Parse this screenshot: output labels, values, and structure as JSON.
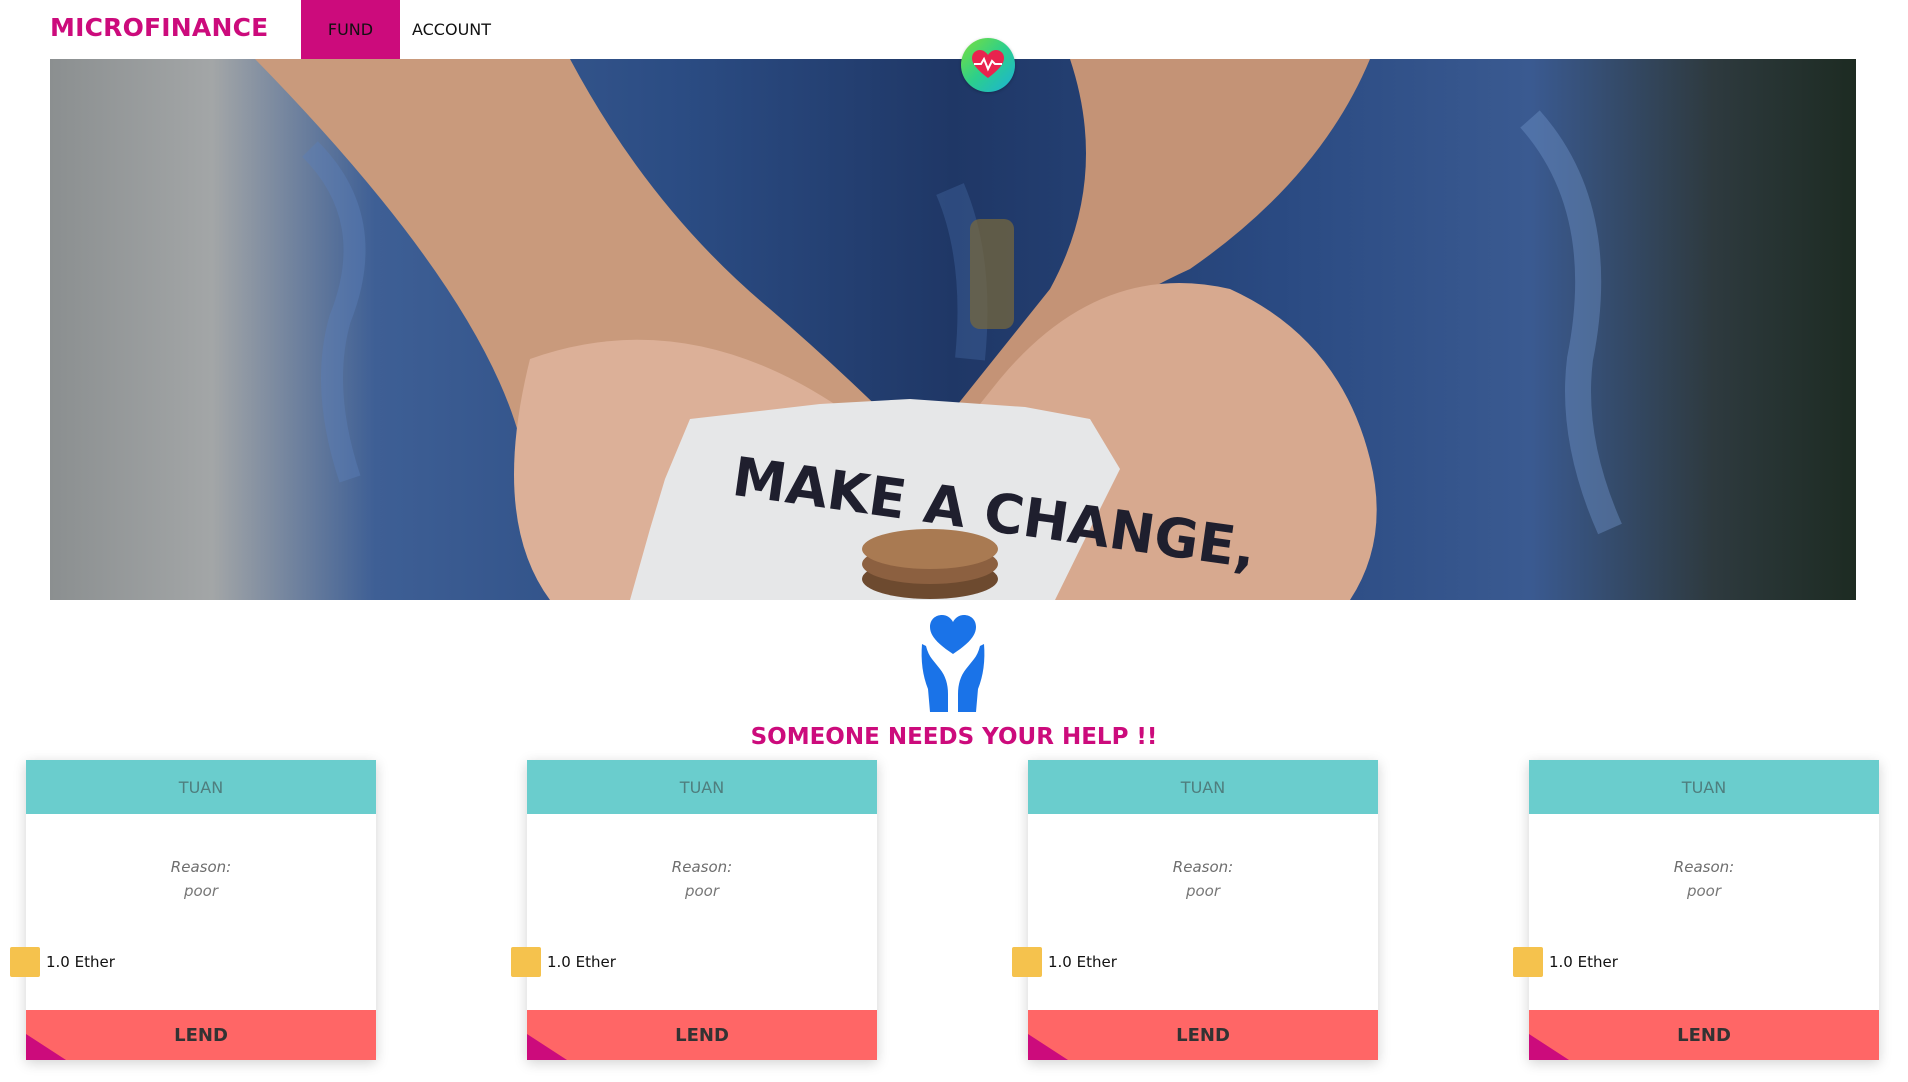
{
  "nav": {
    "brand": "MICROFINANCE",
    "items": [
      {
        "label": "FUND",
        "active": true
      },
      {
        "label": "ACCOUNT",
        "active": false
      }
    ],
    "accent_color": "#cc0b7c"
  },
  "hero": {
    "note_text": "MAKE A CHANGE,",
    "logo_icon": "heart-pulse-icon"
  },
  "help": {
    "icon": "hands-heart-icon",
    "title": "SOMEONE NEEDS YOUR HELP !!"
  },
  "cards": [
    {
      "name": "TUAN",
      "reason_label": "Reason:",
      "reason": "poor",
      "amount": "1.0 Ether",
      "action": "LEND"
    },
    {
      "name": "TUAN",
      "reason_label": "Reason:",
      "reason": "poor",
      "amount": "1.0 Ether",
      "action": "LEND"
    },
    {
      "name": "TUAN",
      "reason_label": "Reason:",
      "reason": "poor",
      "amount": "1.0 Ether",
      "action": "LEND"
    },
    {
      "name": "TUAN",
      "reason_label": "Reason:",
      "reason": "poor",
      "amount": "1.0 Ether",
      "action": "LEND"
    }
  ],
  "colors": {
    "card_header": "#6acdcd",
    "lend_button": "#ff6666",
    "ether_icon": "#f5c24d",
    "help_icon": "#1a73e8"
  }
}
